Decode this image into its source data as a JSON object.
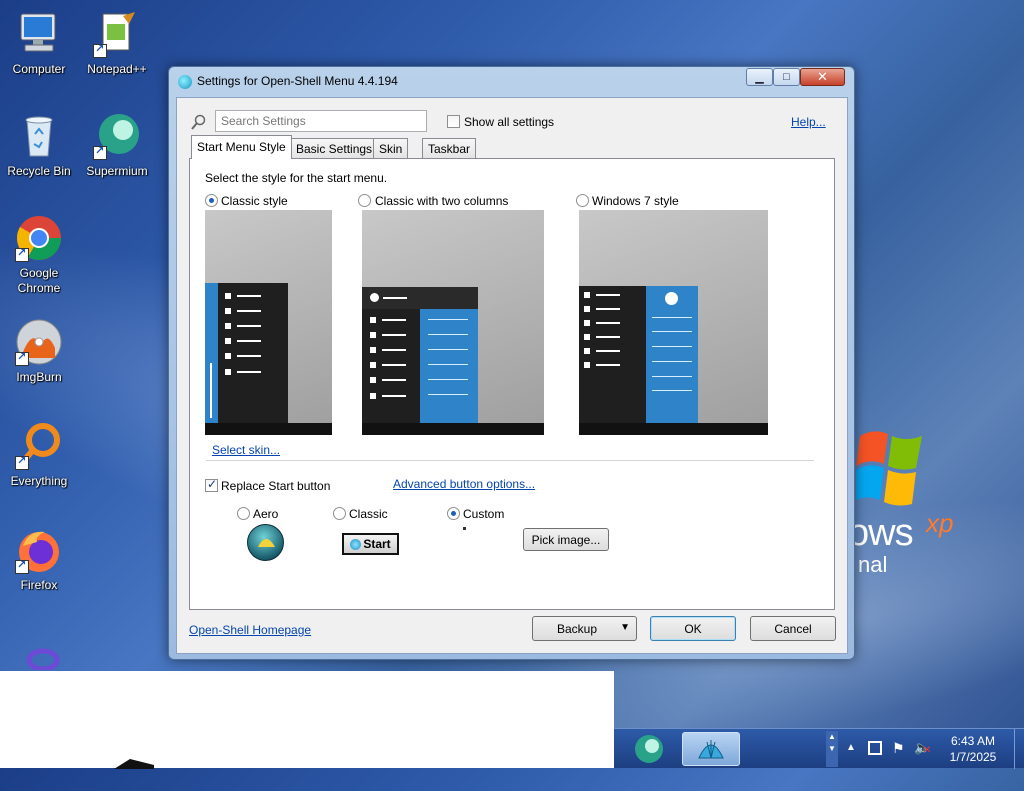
{
  "desktop": {
    "icons": [
      {
        "label": "Computer"
      },
      {
        "label": "Notepad++"
      },
      {
        "label": "Recycle Bin"
      },
      {
        "label": "Supermium"
      },
      {
        "label": "Google Chrome"
      },
      {
        "label": "ImgBurn"
      },
      {
        "label": "Everything"
      },
      {
        "label": "Firefox"
      }
    ],
    "wallpaper_text": {
      "word": "ows",
      "sup": "xp",
      "sub": "nal"
    }
  },
  "dialog": {
    "title": "Settings for Open-Shell Menu 4.4.194",
    "search_placeholder": "Search Settings",
    "show_all_label": "Show all settings",
    "show_all_checked": false,
    "help_link": "Help...",
    "tabs": [
      {
        "label": "Start Menu Style",
        "active": true
      },
      {
        "label": "Basic Settings",
        "active": false
      },
      {
        "label": "Skin",
        "active": false
      },
      {
        "label": "Taskbar",
        "active": false
      }
    ],
    "prompt": "Select the style for the start menu.",
    "styles": [
      {
        "label": "Classic style",
        "selected": true
      },
      {
        "label": "Classic with two columns",
        "selected": false
      },
      {
        "label": "Windows 7 style",
        "selected": false
      }
    ],
    "select_skin_link": "Select skin...",
    "replace_start_label": "Replace Start button",
    "replace_start_checked": true,
    "advanced_link": "Advanced button options...",
    "button_styles": [
      {
        "label": "Aero",
        "selected": false
      },
      {
        "label": "Classic",
        "selected": false
      },
      {
        "label": "Custom",
        "selected": true
      }
    ],
    "classic_start_label": "Start",
    "pick_image_label": "Pick image...",
    "homepage_link": "Open-Shell Homepage",
    "backup_label": "Backup",
    "ok_label": "OK",
    "cancel_label": "Cancel"
  },
  "taskbar": {
    "time": "6:43 AM",
    "date": "1/7/2025"
  },
  "colors": {
    "accent_blue": "#2f83c9",
    "menu_dark": "#1f1f1f",
    "link": "#0645ad"
  }
}
